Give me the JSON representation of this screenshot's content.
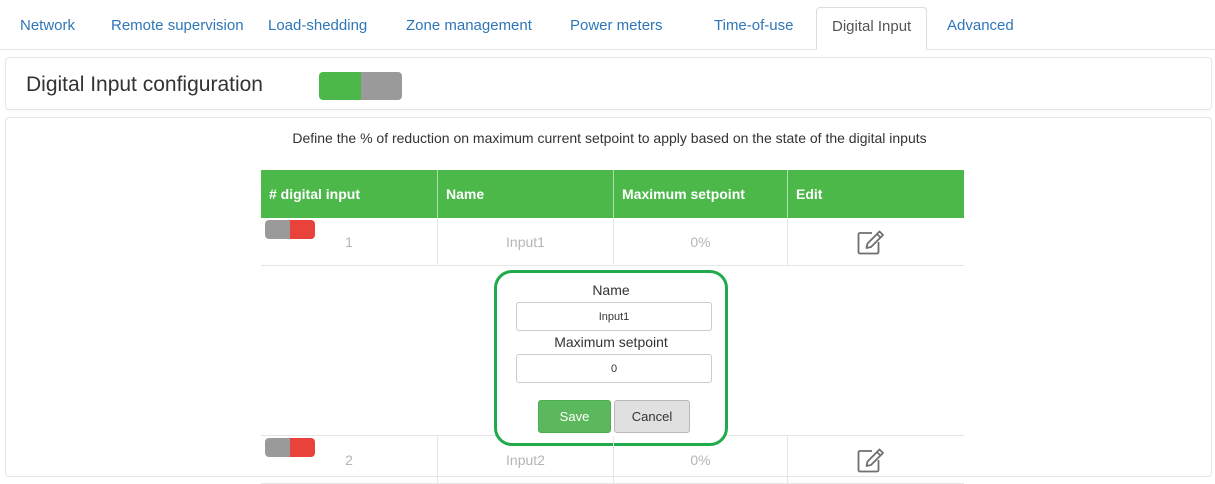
{
  "tabs": [
    {
      "label": "Network"
    },
    {
      "label": "Remote supervision"
    },
    {
      "label": "Load-shedding"
    },
    {
      "label": "Zone management"
    },
    {
      "label": "Power meters"
    },
    {
      "label": "Time-of-use"
    },
    {
      "label": "Digital Input",
      "active": true
    },
    {
      "label": "Advanced"
    }
  ],
  "header": {
    "title": "Digital Input configuration",
    "master_toggle": {
      "state": "on",
      "on_color": "#4db84a",
      "off_color": "#9a9a9a"
    }
  },
  "description": "Define the % of reduction on maximum current setpoint to apply based on the state of the digital inputs",
  "table": {
    "header_color": "#4db84a",
    "columns": [
      "# digital input",
      "Name",
      "Maximum setpoint",
      "Edit"
    ],
    "rows": [
      {
        "number": "1",
        "name": "Input1",
        "setpoint": "0%",
        "toggle_state": "off"
      },
      {
        "number": "2",
        "name": "Input2",
        "setpoint": "0%",
        "toggle_state": "off"
      }
    ]
  },
  "editor": {
    "name_label": "Name",
    "name_value": "Input1",
    "setpoint_label": "Maximum setpoint",
    "setpoint_value": "0",
    "save_label": "Save",
    "cancel_label": "Cancel",
    "highlight_color": "#1faa4b"
  },
  "icons": {
    "edit": "edit-pencil-icon"
  }
}
